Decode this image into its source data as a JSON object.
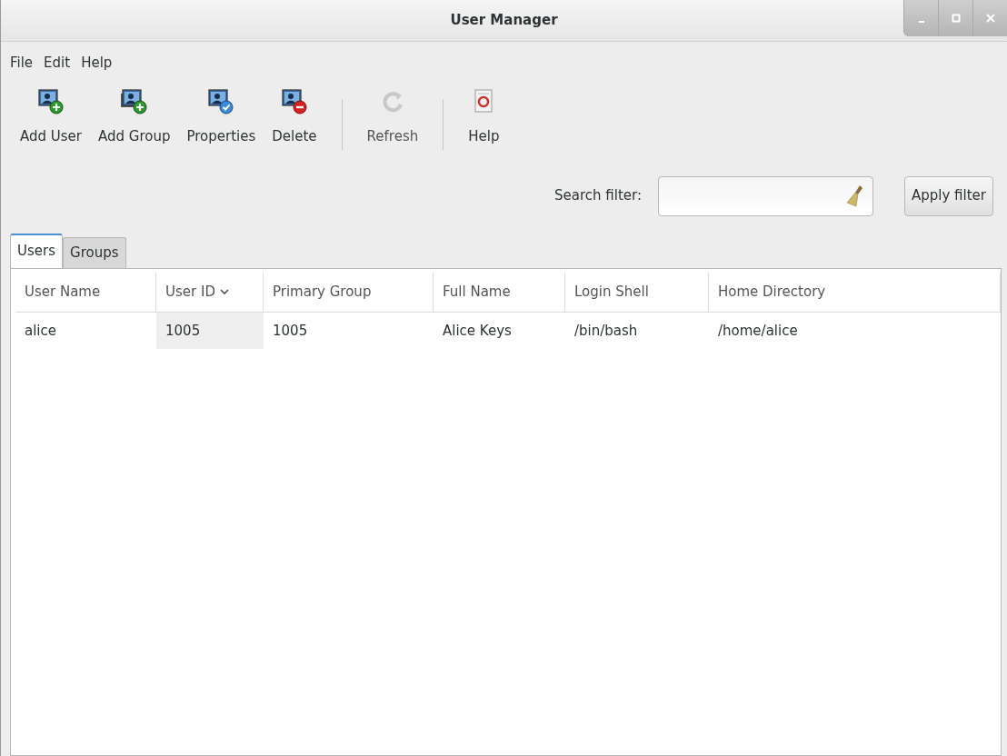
{
  "window": {
    "title": "User Manager"
  },
  "menu": [
    "File",
    "Edit",
    "Help"
  ],
  "toolbar": [
    {
      "kind": "button",
      "label": "Add User",
      "disabled": false
    },
    {
      "kind": "button",
      "label": "Add Group",
      "disabled": false
    },
    {
      "kind": "button",
      "label": "Properties",
      "disabled": false
    },
    {
      "kind": "button",
      "label": "Delete",
      "disabled": false
    },
    {
      "kind": "separator"
    },
    {
      "kind": "button",
      "label": "Refresh",
      "disabled": true
    },
    {
      "kind": "separator"
    },
    {
      "kind": "button",
      "label": "Help",
      "disabled": false
    }
  ],
  "filter": {
    "label": "Search filter:",
    "button": "Apply filter"
  },
  "tabs": [
    {
      "label": "Users",
      "selected": true
    },
    {
      "label": "Groups",
      "selected": false
    }
  ],
  "table": {
    "columns": [
      {
        "label": "User Name",
        "sorted": false
      },
      {
        "label": "User ID",
        "sorted": true
      },
      {
        "label": "Primary Group",
        "sorted": false
      },
      {
        "label": "Full Name",
        "sorted": false
      },
      {
        "label": "Login Shell",
        "sorted": false
      },
      {
        "label": "Home Directory",
        "sorted": false
      }
    ],
    "rows": [
      [
        "alice",
        "1005",
        "1005",
        "Alice Keys",
        "/bin/bash",
        "/home/alice"
      ]
    ]
  }
}
